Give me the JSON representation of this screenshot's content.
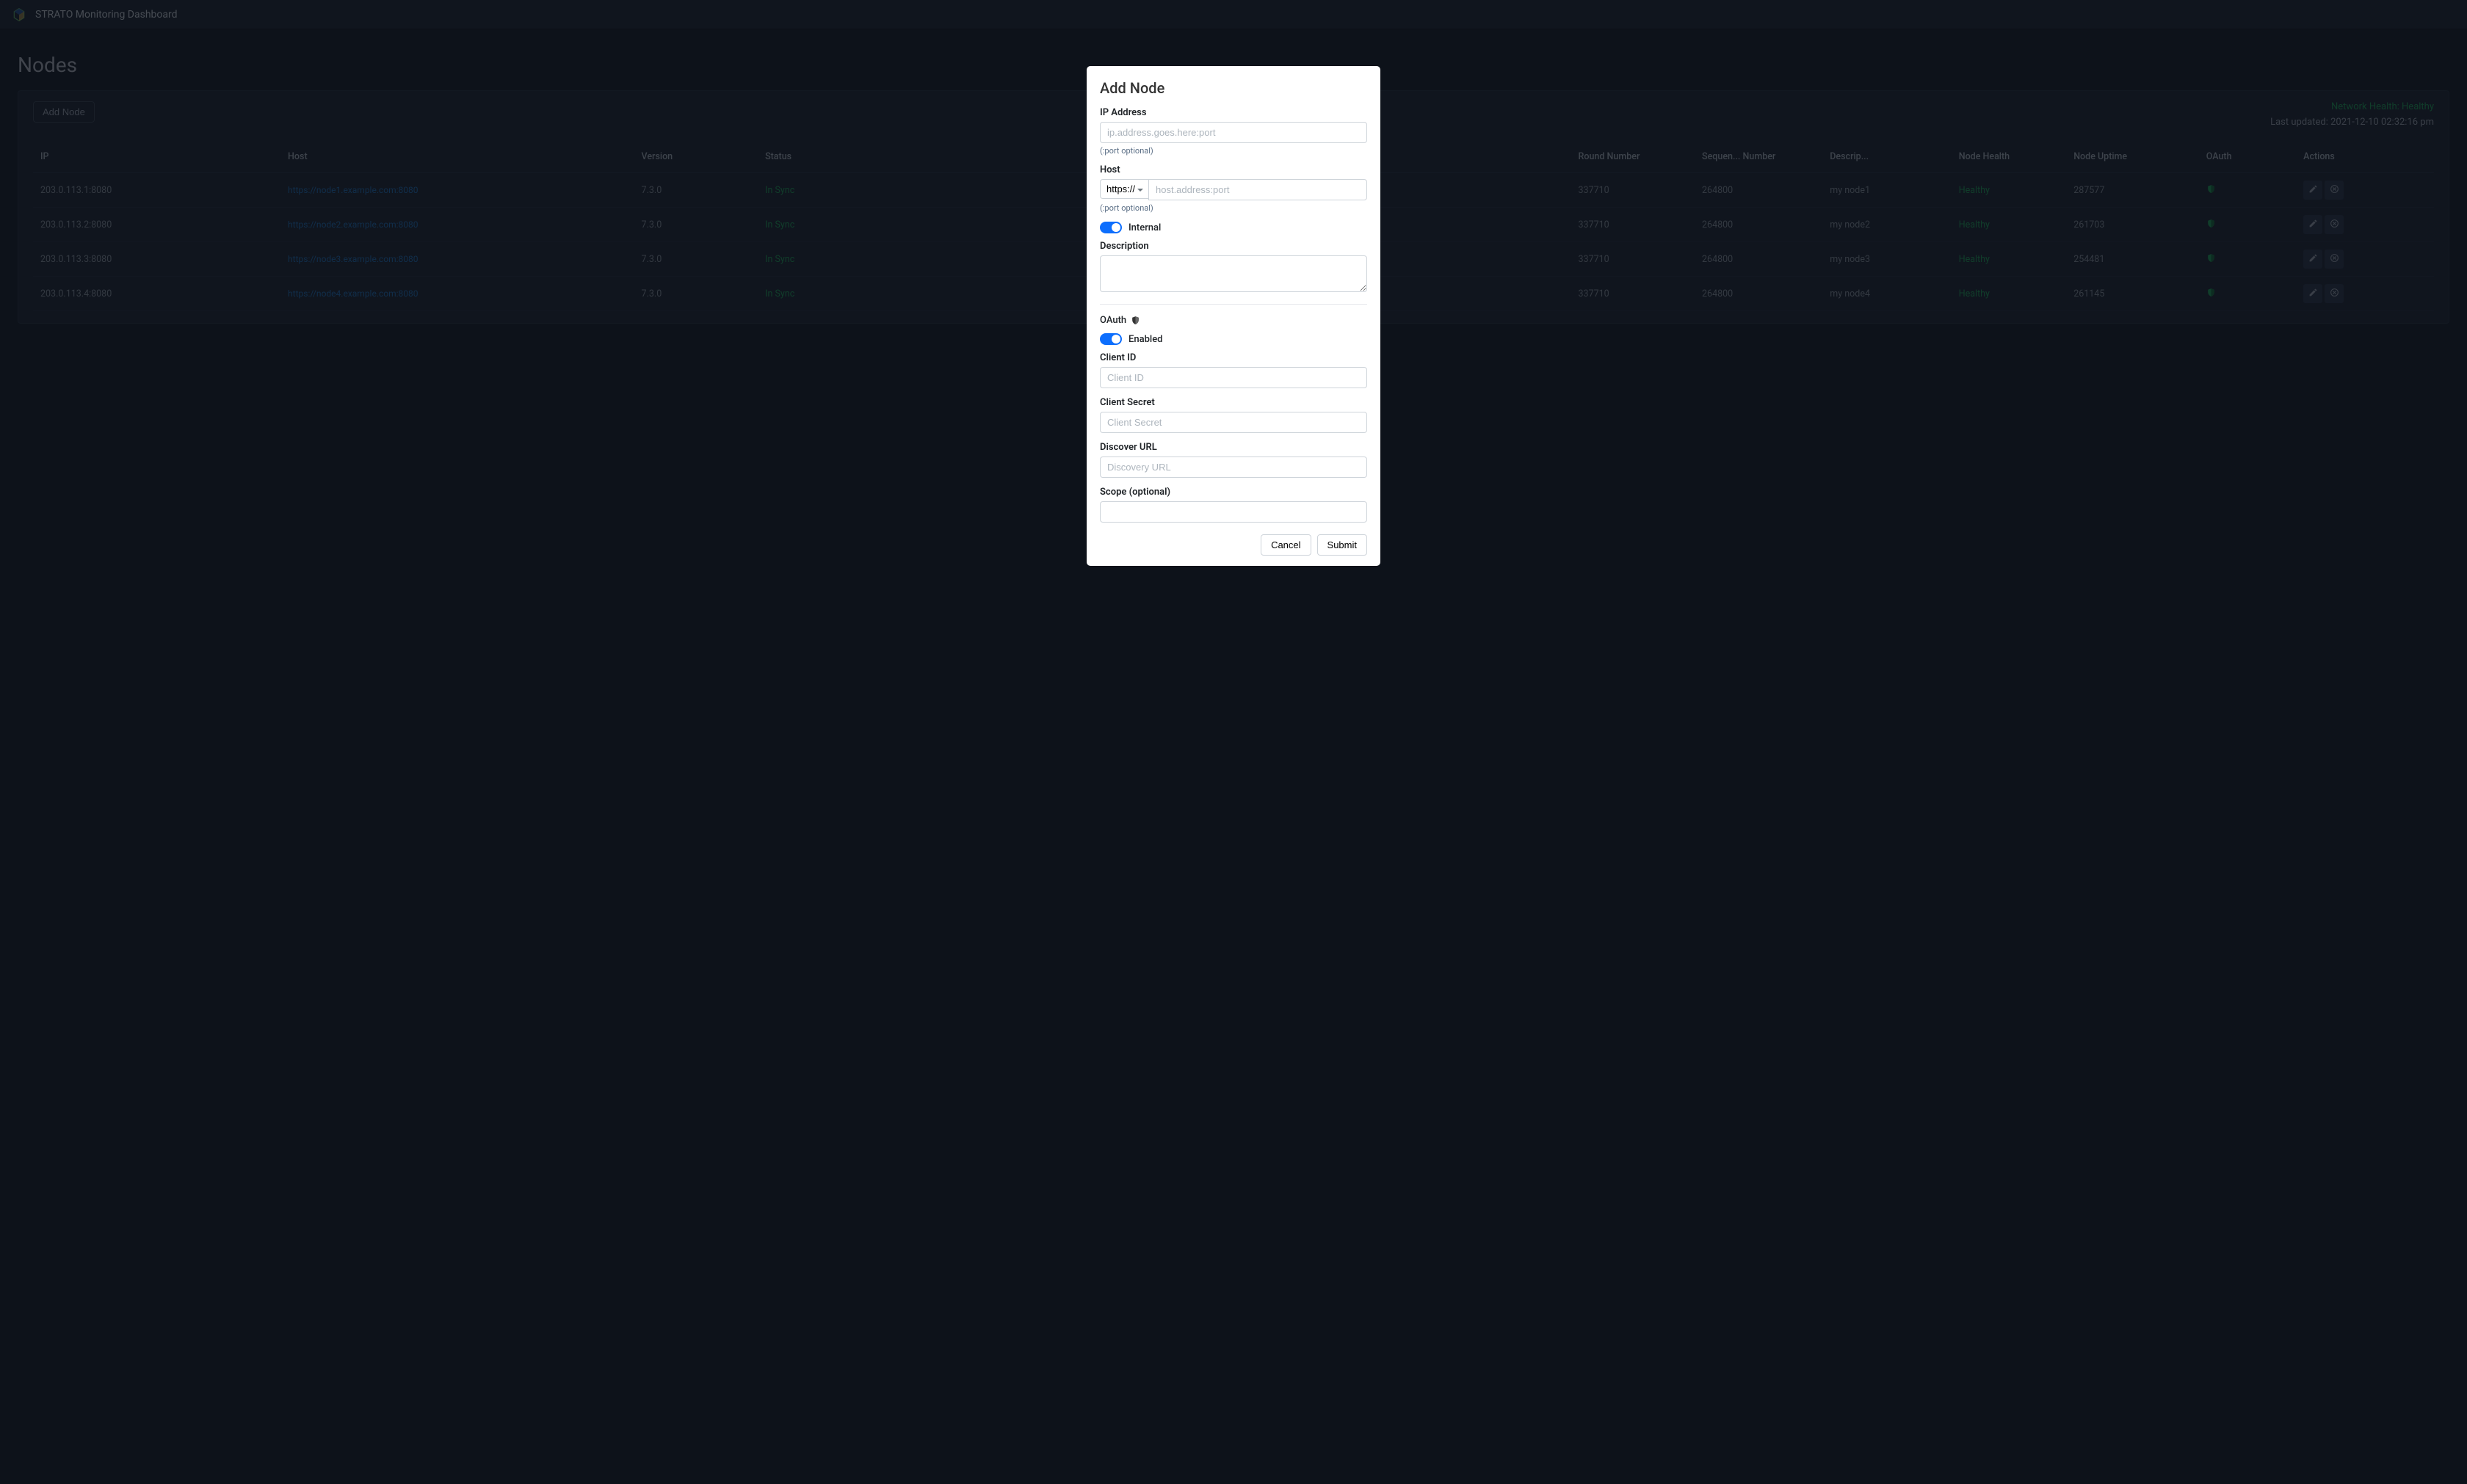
{
  "topbar": {
    "title": "STRATO Monitoring Dashboard"
  },
  "page": {
    "title": "Nodes",
    "add_button": "Add Node",
    "network_health_label": "Network Health: ",
    "network_health_value": "Healthy",
    "last_updated_label": "Last updated: ",
    "last_updated_value": "2021-12-10 02:32:16 pm"
  },
  "table": {
    "headers": {
      "ip": "IP",
      "host": "Host",
      "version": "Version",
      "status": "Status",
      "round": "Round Number",
      "sequence": "Sequen... Number",
      "description": "Descrip...",
      "health": "Node Health",
      "uptime": "Node Uptime",
      "oauth": "OAuth",
      "actions": "Actions"
    },
    "rows": [
      {
        "ip": "203.0.113.1:8080",
        "host": "https://node1.example.com:8080",
        "version": "7.3.0",
        "status": "In Sync",
        "round": "337710",
        "sequence": "264800",
        "description": "my node1",
        "health": "Healthy",
        "uptime": "287577"
      },
      {
        "ip": "203.0.113.2:8080",
        "host": "https://node2.example.com:8080",
        "version": "7.3.0",
        "status": "In Sync",
        "round": "337710",
        "sequence": "264800",
        "description": "my node2",
        "health": "Healthy",
        "uptime": "261703"
      },
      {
        "ip": "203.0.113.3:8080",
        "host": "https://node3.example.com:8080",
        "version": "7.3.0",
        "status": "In Sync",
        "round": "337710",
        "sequence": "264800",
        "description": "my node3",
        "health": "Healthy",
        "uptime": "254481"
      },
      {
        "ip": "203.0.113.4:8080",
        "host": "https://node4.example.com:8080",
        "version": "7.3.0",
        "status": "In Sync",
        "round": "337710",
        "sequence": "264800",
        "description": "my node4",
        "health": "Healthy",
        "uptime": "261145"
      }
    ]
  },
  "modal": {
    "title": "Add Node",
    "ip_label": "IP Address",
    "ip_placeholder": "ip.address.goes.here:port",
    "port_hint": "(:port optional)",
    "host_label": "Host",
    "host_scheme": "https://",
    "host_placeholder": "host.address:port",
    "internal_label": "Internal",
    "description_label": "Description",
    "oauth_heading": "OAuth",
    "enabled_label": "Enabled",
    "client_id_label": "Client ID",
    "client_id_placeholder": "Client ID",
    "client_secret_label": "Client Secret",
    "client_secret_placeholder": "Client Secret",
    "discover_label": "Discover URL",
    "discover_placeholder": "Discovery URL",
    "scope_label": "Scope (optional)",
    "cancel_btn": "Cancel",
    "submit_btn": "Submit"
  }
}
